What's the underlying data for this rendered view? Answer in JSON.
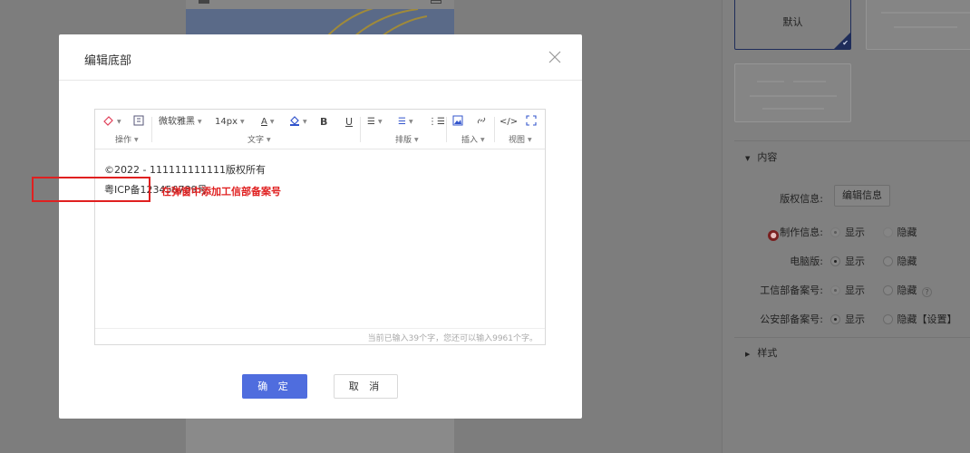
{
  "modal": {
    "title": "编辑底部",
    "ok_label": "确 定",
    "cancel_label": "取 消"
  },
  "toolbar": {
    "font_family": "微软雅黑",
    "font_size": "14px",
    "bold": "B",
    "underline": "U",
    "text_color_glyph": "A",
    "code_glyph": "</>",
    "groups": {
      "operate": "操作",
      "text": "文字",
      "layout": "排版",
      "insert": "插入",
      "view": "视图"
    }
  },
  "editor": {
    "line1": "©2022 - 111111111111版权所有",
    "line2": "粤ICP备123456789号",
    "counter": "当前已输入39个字，您还可以输入9961个字。"
  },
  "annotation": {
    "note": "在弹窗中添加工信部备案号",
    "color": "#e02020"
  },
  "right_panel": {
    "template_default_label": "默认",
    "section_content": "内容",
    "section_style": "样式",
    "rows": [
      {
        "label": "版权信息:",
        "button": "编辑信息"
      },
      {
        "label": "制作信息:",
        "opt1": "显示",
        "opt2": "隐藏"
      },
      {
        "label": "电脑版:",
        "opt1": "显示",
        "opt2": "隐藏"
      },
      {
        "label": "工信部备案号:",
        "opt1": "显示",
        "opt2": "隐藏"
      },
      {
        "label": "公安部备案号:",
        "opt1": "显示",
        "opt2": "隐藏",
        "extra": "【设置】"
      }
    ]
  },
  "colors": {
    "primary": "#4f6dde",
    "overlay": "#7f7f7f",
    "selected_border": "#1f2d5a"
  }
}
